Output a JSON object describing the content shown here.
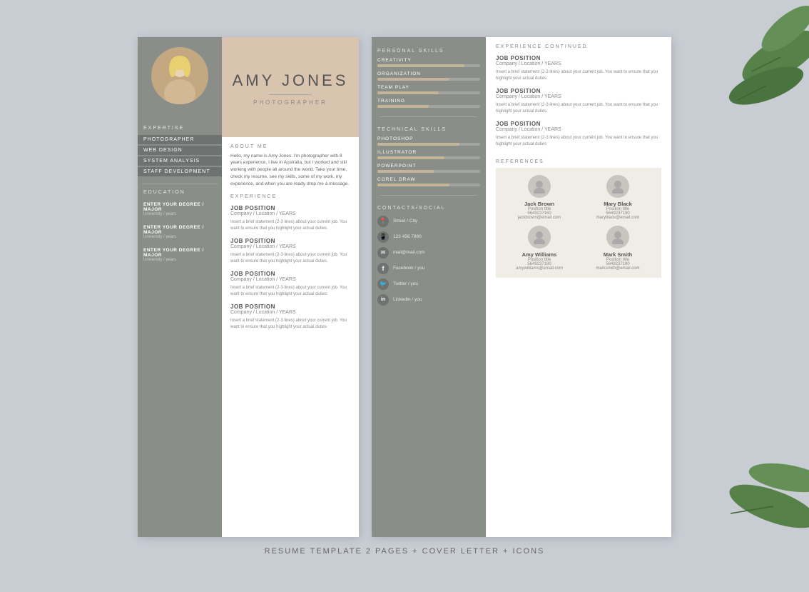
{
  "background_color": "#c8cdd4",
  "caption": "RESUME TEMPLATE 2 PAGES + COVER LETTER + ICONS",
  "page1": {
    "sidebar": {
      "expertise_label": "EXPERTISE",
      "items": [
        "PHOTOGRAPHER",
        "WEB DESIGN",
        "SYSTEM ANALYSIS",
        "STAFF DEVELOPMENT"
      ],
      "education_label": "EDUCATION",
      "edu_items": [
        {
          "degree": "ENTER YOUR DEGREE / MAJOR",
          "sub": "University / years"
        },
        {
          "degree": "ENTER YOUR DEGREE / MAJOR",
          "sub": "University / years"
        },
        {
          "degree": "ENTER YOUR DEGREE / MAJOR",
          "sub": "University / years"
        }
      ]
    },
    "header": {
      "name": "AMY JONES",
      "subtitle": "PHOTOGRAPHER"
    },
    "about": {
      "label": "ABOUT ME",
      "text": "Hello, my name is Amy Jones. I'm photographer with 8 years experience. I live in Australia, but I worked and still working with people all around the world. Take your time, check my resume, see my skills, some of my work, my experience, and when you are ready drop me a message."
    },
    "experience": {
      "label": "EXPERIENCE",
      "jobs": [
        {
          "title": "JOB POSITION",
          "company": "Company / Location / YEARS",
          "desc": "Insert a brief statement (2-3 lines) about your current job. You want to ensure that you highlight your actual duties."
        },
        {
          "title": "JOB POSITION",
          "company": "Company / Location / YEARS",
          "desc": "Insert a brief statement (2-3 lines) about your current job. You want to ensure that you highlight your actual duties."
        },
        {
          "title": "JOB POSITION",
          "company": "Company / Location / YEARS",
          "desc": "Insert a brief statement (2-3 lines) about your current job. You want to ensure that you highlight your actual duties."
        },
        {
          "title": "JOB POSITION",
          "company": "Company / Location / YEARS",
          "desc": "Insert a brief statement (2-3 lines) about your current job. You want to ensure that you highlight your actual duties"
        }
      ]
    }
  },
  "page2": {
    "personal_skills": {
      "label": "PERSONAL SKILLS",
      "items": [
        {
          "name": "CREATIVITY",
          "pct": 85
        },
        {
          "name": "ORGANIZATION",
          "pct": 70
        },
        {
          "name": "TEAM PLAY",
          "pct": 60
        },
        {
          "name": "TRAINING",
          "pct": 50
        }
      ]
    },
    "technical_skills": {
      "label": "TECHNICAL SKILLS",
      "items": [
        {
          "name": "PHOTOSHOP",
          "pct": 80
        },
        {
          "name": "ILLUSTRATOR",
          "pct": 65
        },
        {
          "name": "POWERPOINT",
          "pct": 55
        },
        {
          "name": "COREL DRAW",
          "pct": 70
        }
      ]
    },
    "contacts": {
      "label": "CONTACTS/SOCIAL",
      "items": [
        {
          "icon": "📍",
          "text": "Street / City"
        },
        {
          "icon": "📱",
          "text": "123 456 7890"
        },
        {
          "icon": "✉",
          "text": "mail@mail.com"
        },
        {
          "icon": "f",
          "text": "Facebook / you"
        },
        {
          "icon": "🐦",
          "text": "Twitter / you"
        },
        {
          "icon": "in",
          "text": "LinkedIn / you"
        }
      ]
    },
    "experience_continued": {
      "label": "EXPERIENCE CONTINUED",
      "jobs": [
        {
          "title": "JOB POSITION",
          "company": "Company / Location / YEARS",
          "desc": "Insert a brief statement (2-3 lines) about your current job. You want to ensure that you highlight your actual duties."
        },
        {
          "title": "JOB POSITION",
          "company": "Company / Location / YEARS",
          "desc": "Insert a brief statement (2-3 lines) about your current job. You want to ensure that you highlight your actual duties."
        },
        {
          "title": "JOB POSITION",
          "company": "Company / Location / YEARS",
          "desc": "Insert a brief statement (2-3 lines) about your current job. You want to ensure that you highlight your actual duties"
        }
      ]
    },
    "references": {
      "label": "REFERENCES",
      "items": [
        {
          "name": "Jack Brown",
          "position": "Position title",
          "phone": "5649237160",
          "email": "jackbrown@email.com"
        },
        {
          "name": "Mary Black",
          "position": "Position title",
          "phone": "5649237190",
          "email": "maryblack@email.com"
        },
        {
          "name": "Amy Williams",
          "position": "Position title",
          "phone": "5649237180",
          "email": "amywilliams@email.com"
        },
        {
          "name": "Mark Smith",
          "position": "Position title",
          "phone": "5649237180",
          "email": "marksmith@email.com"
        }
      ]
    }
  }
}
